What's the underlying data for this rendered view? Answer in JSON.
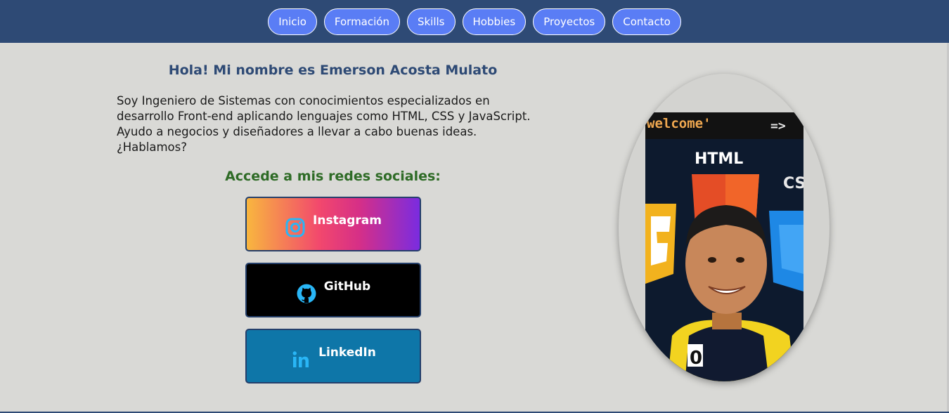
{
  "nav": {
    "items": [
      {
        "label": "Inicio"
      },
      {
        "label": "Formación"
      },
      {
        "label": "Skills"
      },
      {
        "label": "Hobbies"
      },
      {
        "label": "Proyectos"
      },
      {
        "label": "Contacto"
      }
    ]
  },
  "hero": {
    "title": "Hola! Mi nombre es Emerson Acosta Mulato",
    "description": "Soy Ingeniero de Sistemas con conocimientos especializados en desarrollo Front-end aplicando lenguajes como HTML, CSS y JavaScript. Ayudo a negocios y diseñadores a llevar a cabo buenas ideas. ¿Hablamos?"
  },
  "social": {
    "title": "Accede a mis redes sociales:",
    "buttons": [
      {
        "label": "Instagram",
        "icon": "instagram-icon"
      },
      {
        "label": "GitHub",
        "icon": "github-icon"
      },
      {
        "label": "LinkedIn",
        "icon": "linkedin-icon"
      }
    ]
  },
  "photo": {
    "sign_text": "welcome'",
    "arrow_text": "=>",
    "html_label": "HTML",
    "css_label": "CSS",
    "shirt_number": "0"
  },
  "colors": {
    "navbar": "#2e4a75",
    "nav_button": "#5a7df5",
    "background": "#d9d9d6",
    "title": "#2e4a75",
    "social_title": "#2e6b26",
    "github": "#000000",
    "linkedin": "#0e76a8",
    "icon_accent": "#29b6f6"
  }
}
